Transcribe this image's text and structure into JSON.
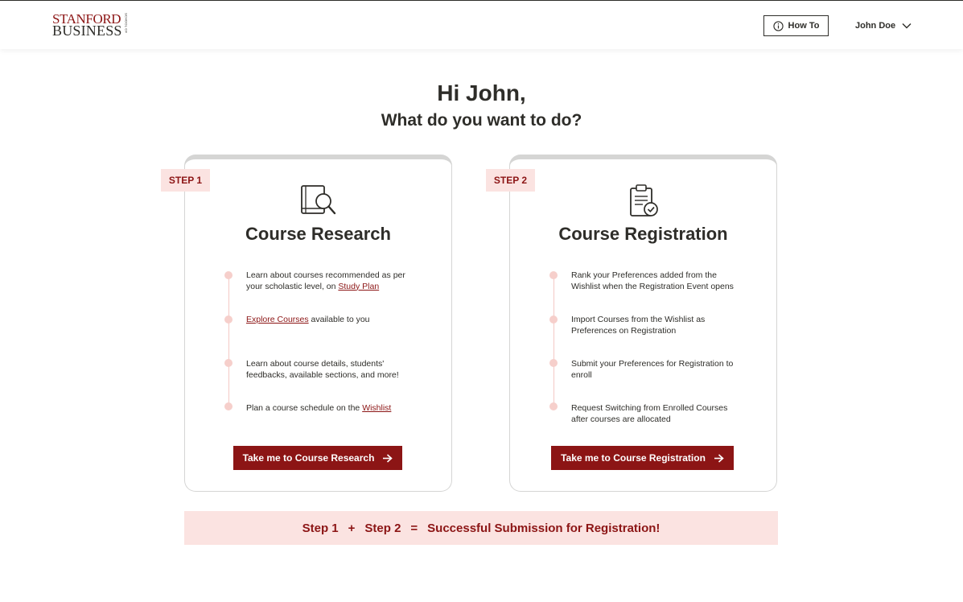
{
  "header": {
    "logo_line1": "STANFORD",
    "logo_line2": "BUSINESS",
    "logo_side": "SCHOOL OF",
    "how_to_label": "How To",
    "user_name": "John Doe"
  },
  "greeting": {
    "title": "Hi John,",
    "subtitle": "What do you want to do?"
  },
  "cards": [
    {
      "step": "STEP 1",
      "title": "Course Research",
      "icon": "book-search-icon",
      "items": [
        {
          "pre": "Learn about courses recommended as per your scholastic level, on ",
          "link": "Study Plan",
          "post": ""
        },
        {
          "pre": "",
          "link": "Explore Courses",
          "post": " available to you"
        },
        {
          "pre": "Learn about course details, students' feedbacks, available sections, and more!",
          "link": "",
          "post": ""
        },
        {
          "pre": "Plan a course schedule on the ",
          "link": "Wishlist",
          "post": ""
        }
      ],
      "cta": "Take me to Course Research"
    },
    {
      "step": "STEP 2",
      "title": "Course Registration",
      "icon": "clipboard-check-icon",
      "items": [
        {
          "pre": "Rank your Preferences added from the Wishlist when the Registration Event opens",
          "link": "",
          "post": ""
        },
        {
          "pre": "Import Courses from the Wishlist as Preferences on Registration",
          "link": "",
          "post": ""
        },
        {
          "pre": "Submit your Preferences for Registration to enroll",
          "link": "",
          "post": ""
        },
        {
          "pre": "Request Switching from Enrolled Courses after courses are allocated",
          "link": "",
          "post": ""
        }
      ],
      "cta": "Take me to Course Registration"
    }
  ],
  "summary": {
    "step1": "Step 1",
    "plus": "+",
    "step2": "Step 2",
    "equals": "=",
    "result": "Successful Submission for Registration!"
  },
  "colors": {
    "brand": "#8c1515",
    "badge_bg": "#fbe3e1",
    "text": "#2e2d29"
  }
}
